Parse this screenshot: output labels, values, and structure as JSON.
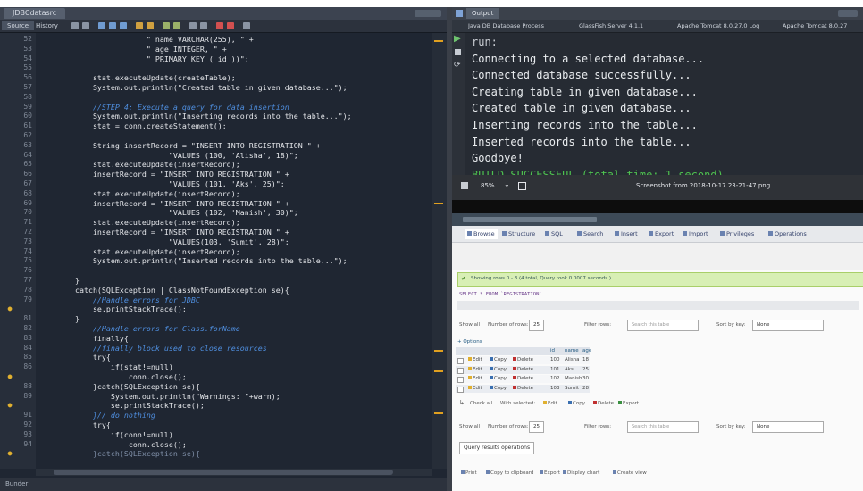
{
  "editor": {
    "tab_label": "JDBCdatasrc",
    "toolbar_source": "Source",
    "toolbar_history": "History",
    "status": "Bunder",
    "line_numbers": [
      "52",
      "53",
      "54",
      "55",
      "56",
      "57",
      "58",
      "59",
      "60",
      "61",
      "62",
      "63",
      "64",
      "65",
      "66",
      "67",
      "68",
      "69",
      "70",
      "71",
      "72",
      "73",
      "74",
      "75",
      "76",
      "77",
      "78",
      "79",
      "",
      "81",
      "82",
      "83",
      "84",
      "85",
      "86",
      "",
      "88",
      "89",
      "",
      "91",
      "92",
      "93",
      "94",
      ""
    ],
    "code_lines": [
      {
        "text": "                        \" name VARCHAR(255), \" +",
        "style": ""
      },
      {
        "text": "                        \" age INTEGER, \" +",
        "style": ""
      },
      {
        "text": "                        \" PRIMARY KEY ( id ))\";",
        "style": ""
      },
      {
        "text": "",
        "style": ""
      },
      {
        "text": "            stat.executeUpdate(createTable);",
        "style": ""
      },
      {
        "text": "            System.out.println(\"Created table in given database...\");",
        "style": ""
      },
      {
        "text": "",
        "style": ""
      },
      {
        "text": "            //STEP 4: Execute a query for data insertion",
        "style": "cm"
      },
      {
        "text": "            System.out.println(\"Inserting records into the table...\");",
        "style": ""
      },
      {
        "text": "            stat = conn.createStatement();",
        "style": ""
      },
      {
        "text": "",
        "style": ""
      },
      {
        "text": "            String insertRecord = \"INSERT INTO REGISTRATION \" +",
        "style": ""
      },
      {
        "text": "                             \"VALUES (100, 'Alisha', 18)\";",
        "style": ""
      },
      {
        "text": "            stat.executeUpdate(insertRecord);",
        "style": ""
      },
      {
        "text": "            insertRecord = \"INSERT INTO REGISTRATION \" +",
        "style": ""
      },
      {
        "text": "                             \"VALUES (101, 'Aks', 25)\";",
        "style": ""
      },
      {
        "text": "            stat.executeUpdate(insertRecord);",
        "style": ""
      },
      {
        "text": "            insertRecord = \"INSERT INTO REGISTRATION \" +",
        "style": ""
      },
      {
        "text": "                             \"VALUES (102, 'Manish', 30)\";",
        "style": ""
      },
      {
        "text": "            stat.executeUpdate(insertRecord);",
        "style": ""
      },
      {
        "text": "            insertRecord = \"INSERT INTO REGISTRATION \" +",
        "style": ""
      },
      {
        "text": "                             \"VALUES(103, 'Sumit', 28)\";",
        "style": ""
      },
      {
        "text": "            stat.executeUpdate(insertRecord);",
        "style": ""
      },
      {
        "text": "            System.out.println(\"Inserted records into the table...\");",
        "style": ""
      },
      {
        "text": "",
        "style": ""
      },
      {
        "text": "        }",
        "style": ""
      },
      {
        "text": "        catch(SQLException | ClassNotFoundException se){",
        "style": ""
      },
      {
        "text": "            //Handle errors for JDBC",
        "style": "cm"
      },
      {
        "text": "            se.printStackTrace();",
        "style": ""
      },
      {
        "text": "        }",
        "style": ""
      },
      {
        "text": "            //Handle errors for Class.forName",
        "style": "cm"
      },
      {
        "text": "            finally{",
        "style": ""
      },
      {
        "text": "            //finally block used to close resources",
        "style": "cm"
      },
      {
        "text": "            try{",
        "style": ""
      },
      {
        "text": "                if(stat!=null)",
        "style": ""
      },
      {
        "text": "                    conn.close();",
        "style": ""
      },
      {
        "text": "            }catch(SQLException se){",
        "style": ""
      },
      {
        "text": "                System.out.println(\"Warnings: \"+warn);",
        "style": ""
      },
      {
        "text": "                se.printStackTrace();",
        "style": ""
      },
      {
        "text": "            }// do nothing",
        "style": "cm"
      },
      {
        "text": "            try{",
        "style": ""
      },
      {
        "text": "                if(conn!=null)",
        "style": ""
      },
      {
        "text": "                    conn.close();",
        "style": ""
      },
      {
        "text": "            }catch(SQLException se){",
        "style": "dm"
      }
    ]
  },
  "output": {
    "title": "Output",
    "tabs": [
      "Java DB Database Process",
      "GlassFish Server 4.1.1",
      "Apache Tomcat 8.0.27.0 Log",
      "Apache Tomcat 8.0.27"
    ],
    "lines": [
      {
        "text": "run:",
        "color": "#c9cdd3"
      },
      {
        "text": "Connecting to a selected database...",
        "color": "#e9ecef"
      },
      {
        "text": "Connected database successfully...",
        "color": "#e9ecef"
      },
      {
        "text": "Creating table in given database...",
        "color": "#e9ecef"
      },
      {
        "text": "Created table in given database...",
        "color": "#e9ecef"
      },
      {
        "text": "Inserting records into the table...",
        "color": "#e9ecef"
      },
      {
        "text": "Inserted records into the table...",
        "color": "#e9ecef"
      },
      {
        "text": "Goodbye!",
        "color": "#e9ecef"
      },
      {
        "text": "BUILD SUCCESSFUL (total time: 1 second)",
        "color": "#4fc24f"
      }
    ]
  },
  "viewer": {
    "zoom": "85%",
    "title": "Screenshot from 2018-10-17 23-21-47.png"
  },
  "pma": {
    "tabs": [
      "Browse",
      "Structure",
      "SQL",
      "Search",
      "Insert",
      "Export",
      "Import",
      "Privileges",
      "Operations"
    ],
    "success_msg": "Showing rows 0 - 3 (4 total, Query took 0.0007 seconds.)",
    "query": "SELECT * FROM `REGISTRATION`",
    "show_all": "Show all",
    "number_of_rows": "Number of rows:",
    "rows_value": "25",
    "filter_rows": "Filter rows:",
    "search_placeholder": "Search this table",
    "sort_by_key": "Sort by key:",
    "sort_value": "None",
    "options": "+ Options",
    "columns": [
      "id",
      "name",
      "age"
    ],
    "rows": [
      {
        "id": "100",
        "name": "Alisha",
        "age": "18"
      },
      {
        "id": "101",
        "name": "Aks",
        "age": "25"
      },
      {
        "id": "102",
        "name": "Manish",
        "age": "30"
      },
      {
        "id": "103",
        "name": "Sumit",
        "age": "28"
      }
    ],
    "row_actions": [
      "Edit",
      "Copy",
      "Delete"
    ],
    "check_all": "Check all",
    "with_selected": "With selected:",
    "bulk_actions": [
      "Edit",
      "Copy",
      "Delete",
      "Export"
    ],
    "query_ops": "Query results operations",
    "bottom_actions": [
      "Print",
      "Copy to clipboard",
      "Export",
      "Display chart",
      "Create view"
    ]
  }
}
